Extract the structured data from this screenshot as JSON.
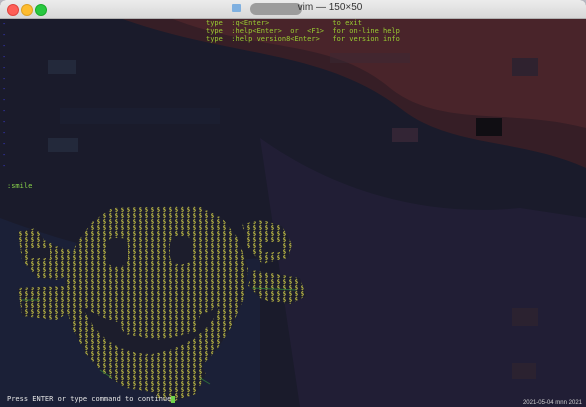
{
  "window": {
    "title": "vim — 150×50"
  },
  "help": {
    "lines": [
      "type  :q<Enter>               to exit",
      "type  :help<Enter>  or  <F1>  for on-line help",
      "type  :help version8<Enter>   for version info"
    ]
  },
  "command": ":smile",
  "status_line": "Press ENTER or type command to continue",
  "clock_text": "2021-05-04 mnn 2021"
}
